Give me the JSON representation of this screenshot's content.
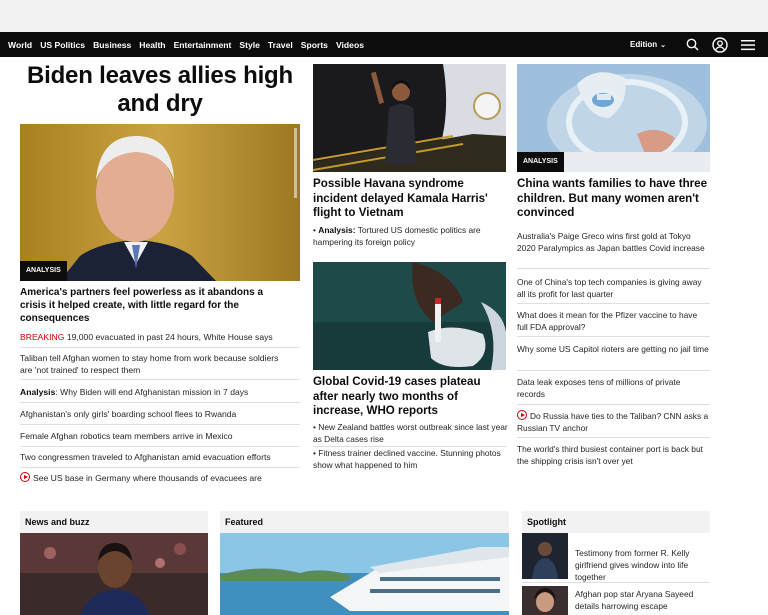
{
  "nav": {
    "links": [
      "World",
      "US Politics",
      "Business",
      "Health",
      "Entertainment",
      "Style",
      "Travel",
      "Sports",
      "Videos"
    ],
    "edition_label": "Edition"
  },
  "col1": {
    "headline": "Biden leaves allies high and dry",
    "badge": "ANALYSIS",
    "lead": "America's partners feel powerless as it abandons a crisis it helped create, with little regard for the consequences",
    "items": {
      "breaking_prefix": "BREAKING",
      "breaking_text": "19,000 evacuated in past 24 hours, White House says",
      "item2": "Taliban tell Afghan women to stay home from work because soldiers are 'not trained' to respect them",
      "analysis_prefix": "Analysis",
      "analysis_text": ": Why Biden will end Afghanistan mission in 7 days",
      "item4": "Afghanistan's only girls' boarding school flees to Rwanda",
      "item5": "Female Afghan robotics team members arrive in Mexico",
      "item6": "Two congressmen traveled to Afghanistan amid evacuation efforts",
      "item7": "See US base in Germany where thousands of evacuees are"
    }
  },
  "col2": {
    "story1_title": "Possible Havana syndrome incident delayed Kamala Harris' flight to Vietnam",
    "story1_bullet_prefix": "Analysis:",
    "story1_bullet": " Tortured US domestic politics are hampering its foreign policy",
    "story2_title": "Global Covid-19 cases plateau after nearly two months of increase, WHO reports",
    "story2_b1": "New Zealand battles worst outbreak since last year as Delta cases rise",
    "story2_b2": "Fitness trainer declined vaccine. Stunning photos show what happened to him"
  },
  "col3": {
    "badge": "ANALYSIS",
    "lead": "China wants families to have three children. But many women aren't convinced",
    "items": [
      "Australia's Paige Greco wins first gold at Tokyo 2020 Paralympics as Japan battles Covid increase",
      "One of China's top tech companies is giving away all its profit for last quarter",
      "What does it mean for the Pfizer vaccine to have full FDA approval?",
      "Why some US Capitol rioters are getting no jail time",
      "Data leak exposes tens of millions of private records",
      "Do Russia have ties to the Taliban? CNN asks a Russian TV anchor",
      "The world's third busiest container port is back but the shipping crisis isn't over yet"
    ]
  },
  "sections": {
    "news_buzz": "News and buzz",
    "featured": "Featured",
    "spotlight": "Spotlight",
    "spot1": "Testimony from former R. Kelly girlfriend gives window into life together",
    "spot2": "Afghan pop star Aryana Sayeed details harrowing escape"
  }
}
